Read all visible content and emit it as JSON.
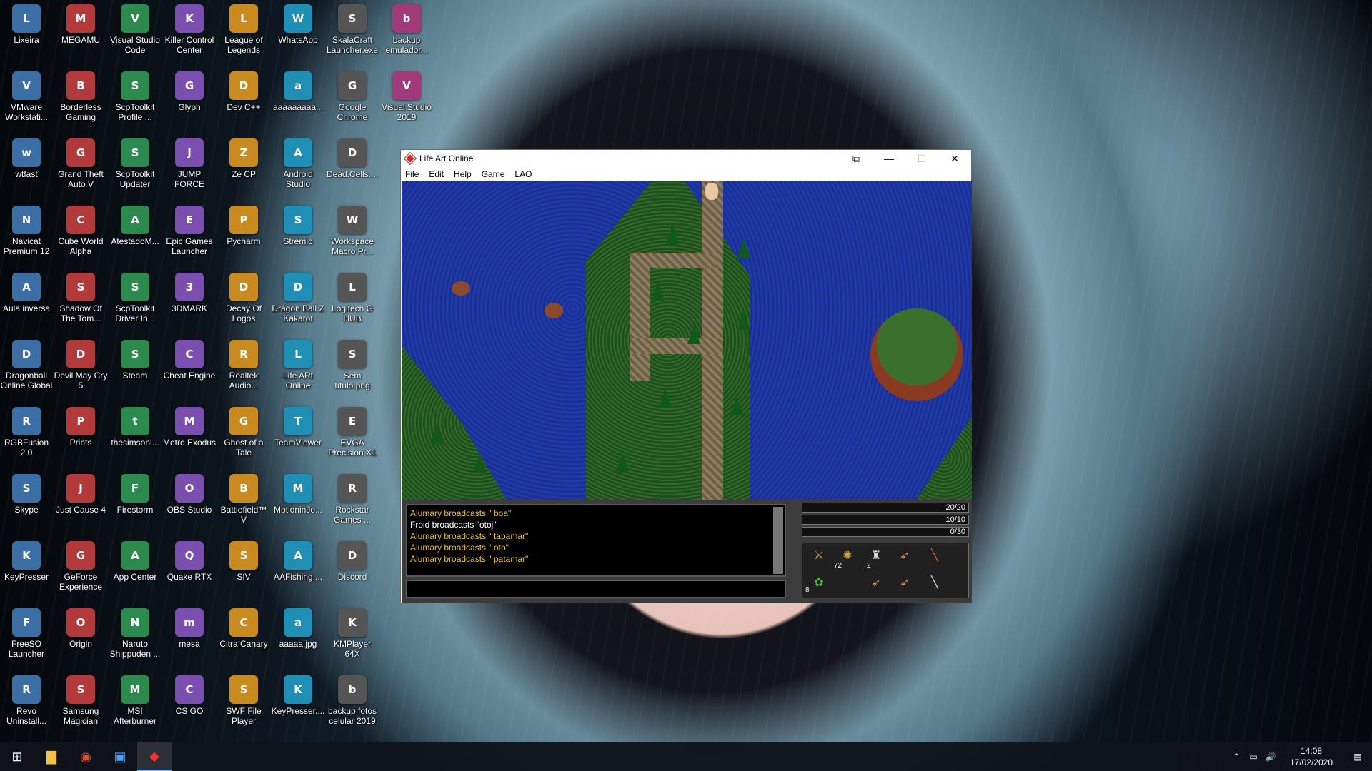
{
  "desktop": {
    "icons": [
      [
        "Lixeira",
        "MEGAMU",
        "Visual Studio Code",
        "Killer Control Center",
        "League of Legends",
        "WhatsApp",
        "SkalaCraft Launcher.exe",
        "backup emulador..."
      ],
      [
        "VMware Workstati...",
        "Borderless Gaming",
        "ScpToolkit Profile ...",
        "Glyph",
        "Dev C++",
        "aaaaaaaaa...",
        "Google Chrome",
        "Visual Studio 2019"
      ],
      [
        "wtfast",
        "Grand Theft Auto V",
        "ScpToolkit Updater",
        "JUMP FORCE",
        "Zé CP",
        "Android Studio",
        "Dead.Cells....",
        ""
      ],
      [
        "Navicat Premium 12",
        "Cube World Alpha",
        "AtestadoM...",
        "Epic Games Launcher",
        "Pycharm",
        "Stremio",
        "Workspace Macro Pr...",
        ""
      ],
      [
        "Aula inversa",
        "Shadow Of The Tom...",
        "ScpToolkit Driver In...",
        "3DMARK",
        "Decay Of Logos",
        "Dragon Ball Z Kakarot",
        "Logitech G HUB",
        ""
      ],
      [
        "Dragonball Online Global",
        "Devil May Cry 5",
        "Steam",
        "Cheat Engine",
        "Realtek Audio...",
        "Life ARt Online",
        "Sem título.png",
        ""
      ],
      [
        "RGBFusion 2.0",
        "Prints",
        "thesimsonl...",
        "Metro Exodus",
        "Ghost of a Tale",
        "TeamViewer",
        "EVGA Precision X1",
        ""
      ],
      [
        "Skype",
        "Just Cause 4",
        "Firestorm",
        "OBS Studio",
        "Battlefield™ V",
        "MotioninJo...",
        "Rockstar Games ...",
        ""
      ],
      [
        "KeyPresser",
        "GeForce Experience",
        "App Center",
        "Quake RTX",
        "SIV",
        "AAFishing....",
        "Discord",
        ""
      ],
      [
        "FreeSO Launcher",
        "Origin",
        "Naruto Shippuden ...",
        "mesa",
        "Citra Canary",
        "aaaaa.jpg",
        "KMPlayer 64X",
        ""
      ],
      [
        "Revo Uninstall...",
        "Samsung Magician",
        "MSI Afterburner",
        "CS GO",
        "SWF File Player",
        "KeyPresser....",
        "backup fotos celular 2019",
        ""
      ]
    ]
  },
  "window": {
    "title": "Life Art Online",
    "menu": [
      "File",
      "Edit",
      "Help",
      "Game",
      "LAO"
    ],
    "chat": [
      {
        "text": "Alumary broadcasts \" boa\"",
        "color": "#e8c040"
      },
      {
        "text": "Froid broadcasts \"otoj\"",
        "color": "#ffffff"
      },
      {
        "text": "Alumary broadcasts \" tapamar\"",
        "color": "#e8c040"
      },
      {
        "text": "Alumary broadcasts \" oto\"",
        "color": "#e8c040"
      },
      {
        "text": "Alumary broadcasts \" patamar\"",
        "color": "#e8c040"
      }
    ],
    "bars": [
      "20/20",
      "10/10",
      "0/30"
    ],
    "inventory_qty": [
      "72",
      "2",
      "8"
    ]
  },
  "taskbar": {
    "clock_time": "14:08",
    "clock_date": "17/02/2020"
  }
}
